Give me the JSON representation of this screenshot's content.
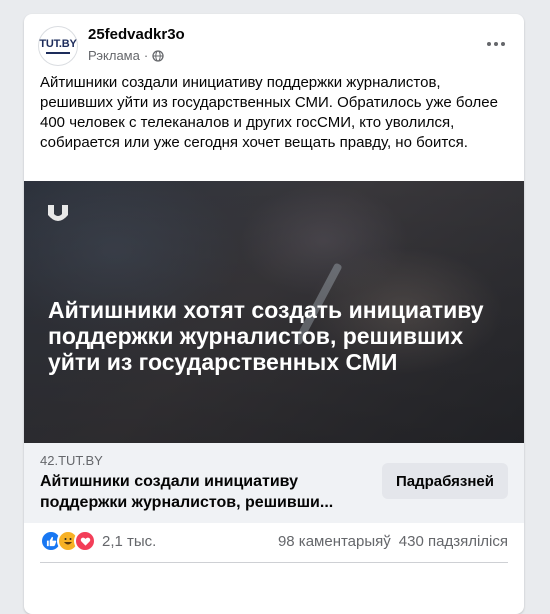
{
  "post": {
    "page_name": "25fedvadkr3o",
    "sponsored_label": "Рэклама",
    "separator": "·",
    "avatar_logo": "TUT.BY",
    "text": "Айтишники создали инициативу поддержки журналистов, решивших уйти из государственных СМИ. Обратилось уже более 400 человек с телеканалов и других госСМИ, кто уволился, собирается или уже сегодня хочет вещать правду, но боится."
  },
  "media": {
    "headline": "Айтишники хотят создать инициативу поддержки журналистов, решивших уйти из государственных СМИ"
  },
  "link": {
    "domain": "42.TUT.BY",
    "title": "Айтишники создали инициативу поддержки журналистов, решивши...",
    "cta_label": "Падрабязней"
  },
  "stats": {
    "reaction_count": "2,1 тыс.",
    "comments": "98 каментарыяў",
    "shares": "430 падзяліліся",
    "reaction_icons": [
      "like-icon",
      "haha-icon",
      "love-icon"
    ]
  },
  "colors": {
    "like": "#1877f2",
    "haha": "#f7b125",
    "love": "#f33e58",
    "link_bg": "#f0f2f5"
  }
}
